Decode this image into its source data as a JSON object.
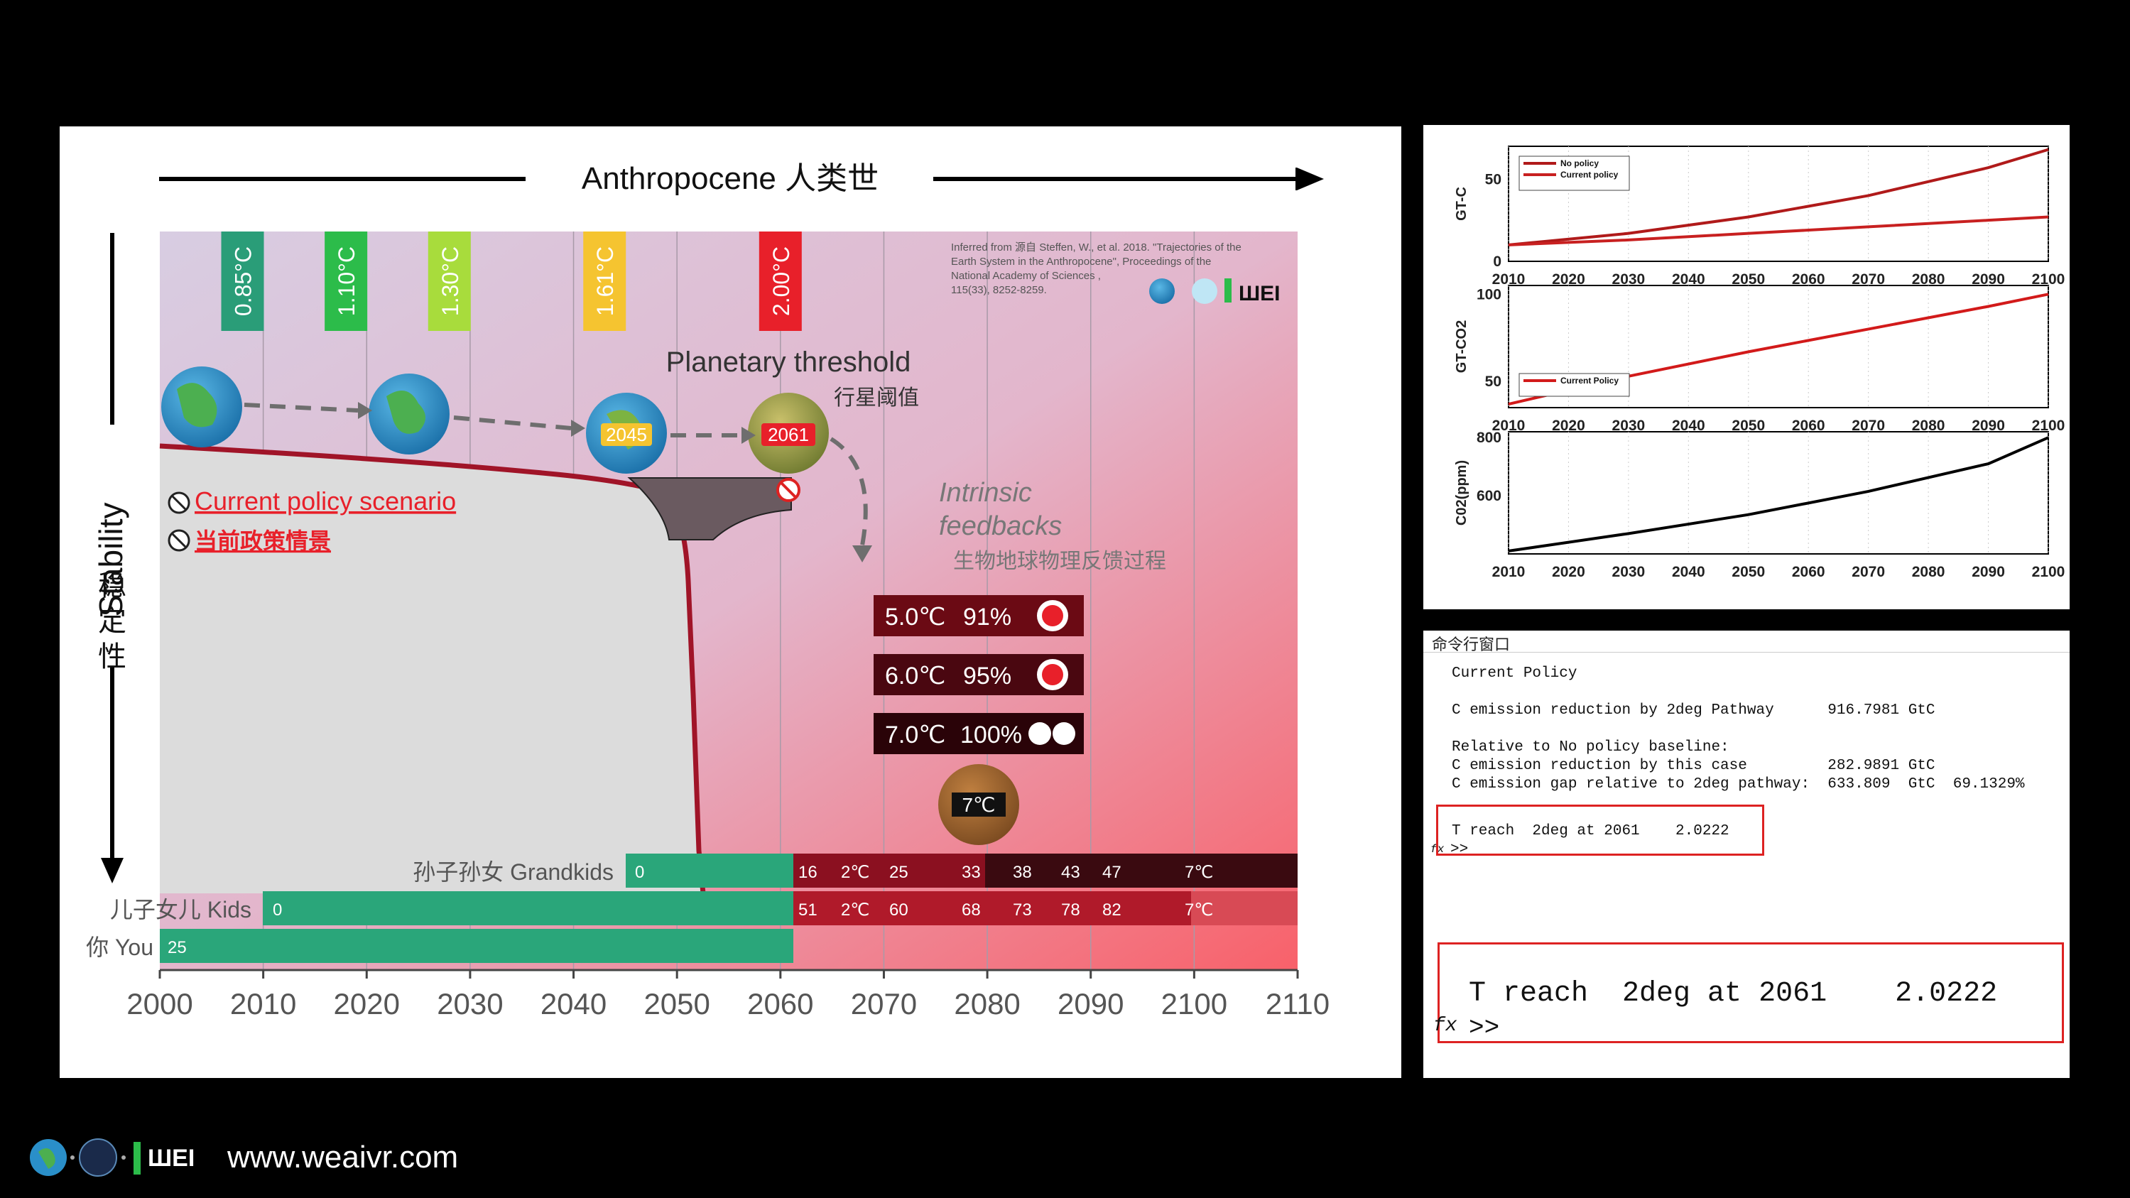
{
  "main": {
    "era_title": "Anthropocene  人类世",
    "y_axis_label": "Stability",
    "y_axis_label_cn": [
      "稳",
      "定",
      "性"
    ],
    "citation": [
      "Inferred from 源自 Steffen, W., et al. 2018. \"Trajectories of the",
      "Earth System in the Anthropocene\", Proceedings of the",
      "National Academy of Sciences ,",
      "115(33), 8252-8259."
    ],
    "temperature_tags": [
      {
        "label": "0.85°C",
        "color": "#2a9d78",
        "year": 2008
      },
      {
        "label": "1.10°C",
        "color": "#2cbc4a",
        "year": 2018
      },
      {
        "label": "1.30°C",
        "color": "#a8dc3c",
        "year": 2028
      },
      {
        "label": "1.61°C",
        "color": "#f5c430",
        "year": 2043
      },
      {
        "label": "2.00°C",
        "color": "#e8202a",
        "year": 2060
      }
    ],
    "globe_badges": [
      "2045",
      "2061"
    ],
    "planetary_threshold": "Planetary threshold",
    "planetary_threshold_cn": "行星阈值",
    "scenario_label": "Current policy scenario",
    "scenario_label_cn": "当前政策情景",
    "feedbacks_label": [
      "Intrinsic",
      "feedbacks"
    ],
    "feedbacks_label_cn": "生物地球物理反馈过程",
    "risk_rows": [
      {
        "temp": "5.0℃",
        "pct": "91%"
      },
      {
        "temp": "6.0℃",
        "pct": "95%"
      },
      {
        "temp": "7.0℃",
        "pct": "100%"
      }
    ],
    "globe_7c": "7℃",
    "generations": [
      {
        "label": "孙子孙女 Grandkids",
        "start_age": "0",
        "ages": [
          "16",
          "2℃",
          "25",
          "33",
          "38",
          "43",
          "47",
          "7℃"
        ]
      },
      {
        "label": "儿子女儿 Kids",
        "start_age": "0",
        "ages": [
          "51",
          "2℃",
          "60",
          "68",
          "73",
          "78",
          "82",
          "7℃"
        ]
      },
      {
        "label": "你 You",
        "start_age": "25",
        "ages": []
      }
    ],
    "x_ticks": [
      "2000",
      "2010",
      "2020",
      "2030",
      "2040",
      "2050",
      "2060",
      "2070",
      "2080",
      "2090",
      "2100",
      "2110"
    ]
  },
  "plots": {
    "ticks_x": [
      "2010",
      "2020",
      "2030",
      "2040",
      "2050",
      "2060",
      "2070",
      "2080",
      "2090",
      "2100"
    ],
    "plot1": {
      "ylabel": "GT-C",
      "yticks": [
        "50",
        "0"
      ],
      "legend": [
        "No policy",
        "Current policy"
      ]
    },
    "plot2": {
      "ylabel": "GT-CO2",
      "yticks": [
        "100",
        "50"
      ],
      "legend": [
        "Current Policy"
      ]
    },
    "plot3": {
      "ylabel": "C02(ppm)",
      "yticks": [
        "800",
        "600"
      ]
    }
  },
  "chart_data": [
    {
      "type": "line",
      "ylabel": "GT-C",
      "x": [
        2010,
        2030,
        2050,
        2070,
        2090,
        2100
      ],
      "series": [
        {
          "name": "No policy",
          "values": [
            10,
            17,
            27,
            40,
            57,
            68
          ]
        },
        {
          "name": "Current policy",
          "values": [
            10,
            13,
            17,
            21,
            25,
            27
          ]
        }
      ],
      "ylim": [
        0,
        70
      ]
    },
    {
      "type": "line",
      "ylabel": "GT-CO2",
      "x": [
        2010,
        2030,
        2050,
        2070,
        2090,
        2100
      ],
      "series": [
        {
          "name": "Current Policy",
          "values": [
            37,
            53,
            67,
            80,
            93,
            100
          ]
        }
      ],
      "ylim": [
        35,
        105
      ]
    },
    {
      "type": "line",
      "ylabel": "C02(ppm)",
      "x": [
        2010,
        2030,
        2050,
        2070,
        2090,
        2100
      ],
      "series": [
        {
          "values": [
            410,
            470,
            535,
            615,
            710,
            800
          ]
        }
      ],
      "ylim": [
        400,
        820
      ]
    }
  ],
  "cmd": {
    "title": "命令行窗口",
    "lines": [
      "Current Policy",
      "",
      "C emission reduction by 2deg Pathway      916.7981 GtC",
      "",
      "Relative to No policy baseline:",
      "C emission reduction by this case         282.9891 GtC",
      "C emission gap relative to 2deg pathway:  633.809  GtC  69.1329%",
      "",
      "",
      "T reach  2deg at 2061    2.0222",
      ">>"
    ],
    "zoom_line": "T reach  2deg at 2061    2.0222",
    "zoom_prompt": ">>",
    "fx": "fx"
  },
  "footer": {
    "url": "www.weaivr.com"
  }
}
